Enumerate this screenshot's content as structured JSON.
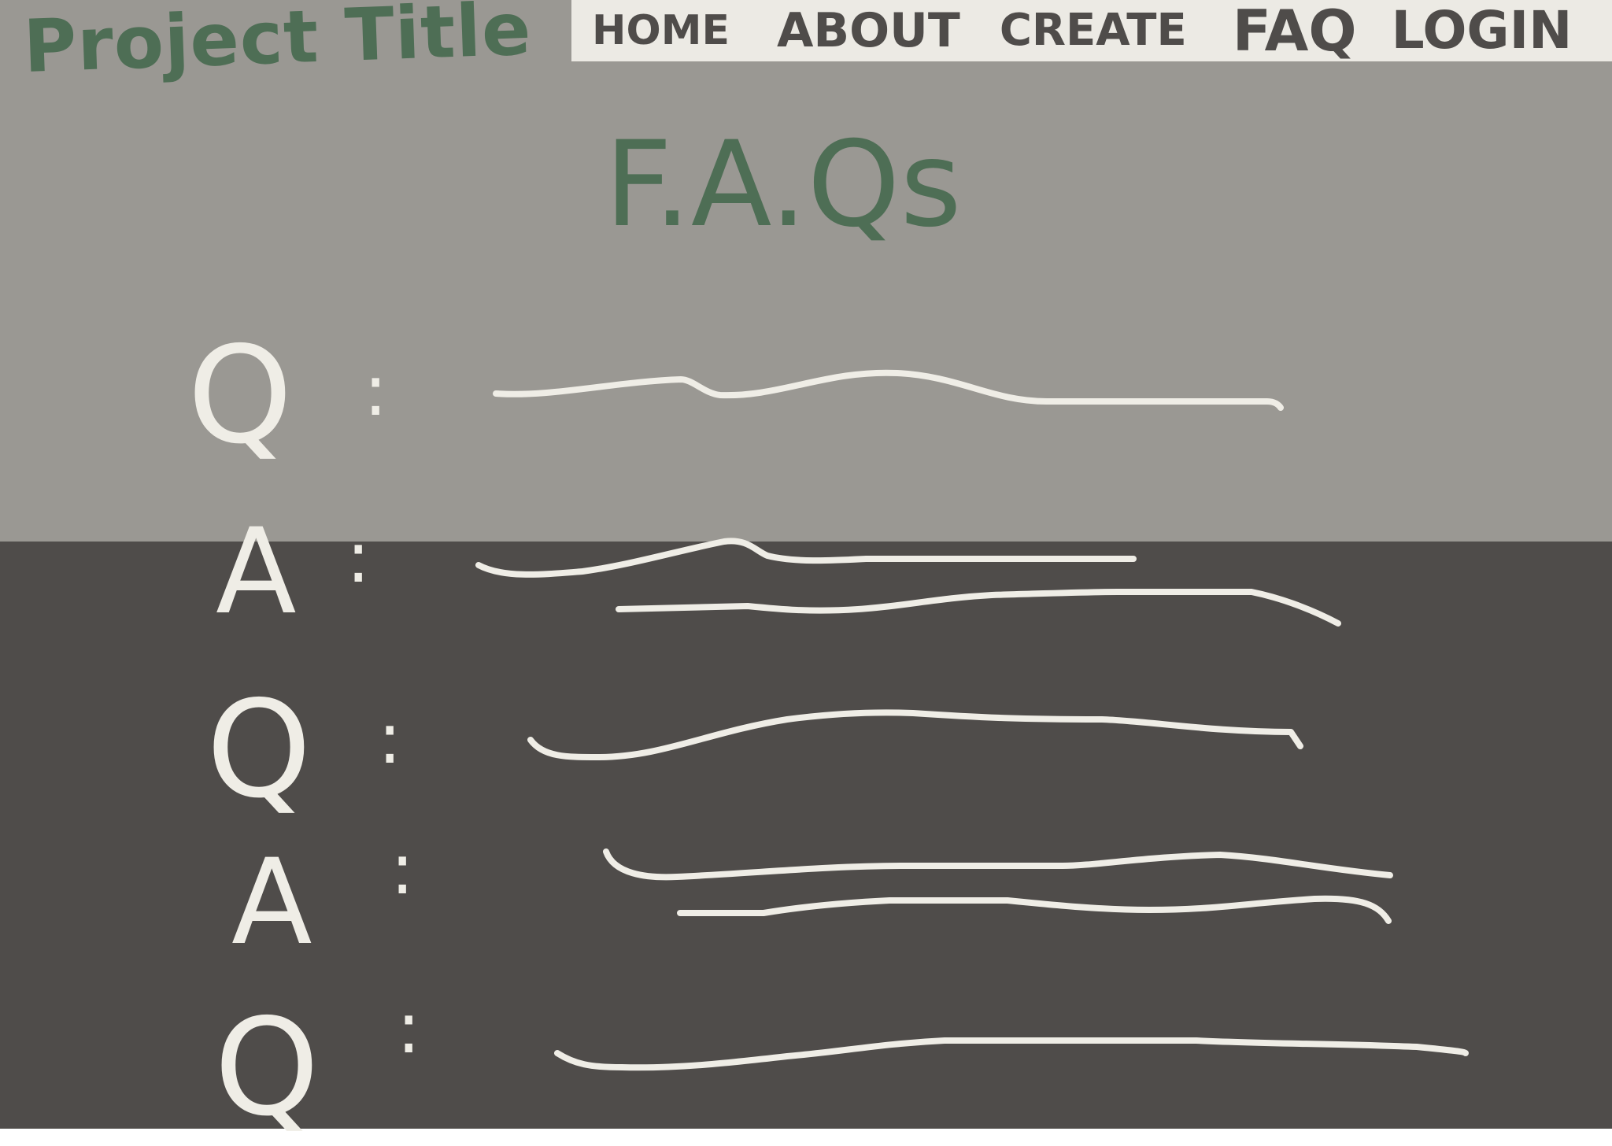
{
  "header": {
    "project_title": "Project Title",
    "nav": [
      "HOME",
      "ABOUT",
      "CREATE",
      "FAQ",
      "LOGIN"
    ]
  },
  "page": {
    "title": "F.A.Qs"
  },
  "faq": {
    "items": [
      {
        "label": "Q",
        "text_lines": 1
      },
      {
        "label": "A",
        "text_lines": 2
      },
      {
        "label": "Q",
        "text_lines": 1
      },
      {
        "label": "A",
        "text_lines": 2
      },
      {
        "label": "Q",
        "text_lines": 1
      }
    ],
    "separator": ":"
  },
  "colors": {
    "accent_green": "#4e6e55",
    "top_bg": "#9a9893",
    "bottom_bg": "#4f4c4a",
    "ink_light": "#efede6",
    "nav_bg": "#eceae4"
  }
}
